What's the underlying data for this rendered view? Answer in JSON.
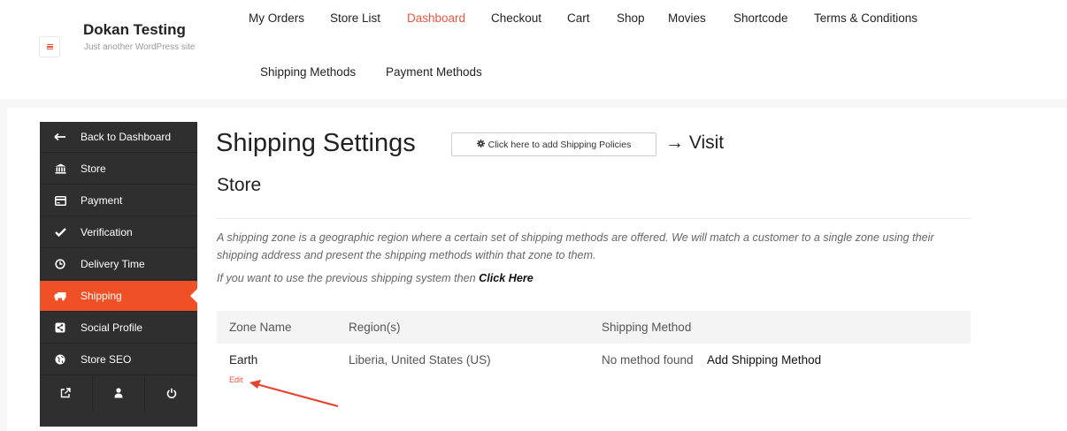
{
  "site": {
    "title": "Dokan Testing",
    "description": "Just another WordPress site"
  },
  "nav": {
    "items": [
      "My Orders",
      "Store List",
      "Dashboard",
      "Checkout",
      "Cart",
      "Shop",
      "Movies",
      "Shortcode",
      "Terms & Conditions",
      "Shipping Methods",
      "Payment Methods"
    ],
    "active": "Dashboard"
  },
  "sidebar": {
    "items": [
      {
        "label": "Back to Dashboard",
        "icon": "arrow-left-icon"
      },
      {
        "label": "Store",
        "icon": "bank-icon"
      },
      {
        "label": "Payment",
        "icon": "credit-card-icon"
      },
      {
        "label": "Verification",
        "icon": "check-icon"
      },
      {
        "label": "Delivery Time",
        "icon": "clock-icon"
      },
      {
        "label": "Shipping",
        "icon": "truck-icon"
      },
      {
        "label": "Social Profile",
        "icon": "share-icon"
      },
      {
        "label": "Store SEO",
        "icon": "globe-icon"
      }
    ],
    "active": "Shipping",
    "footer_icons": [
      "external-link-icon",
      "user-icon",
      "power-icon"
    ]
  },
  "main": {
    "title": "Shipping Settings",
    "policy_button": "Click here to add Shipping Policies",
    "visit": "→ Visit",
    "store_heading": "Store",
    "description": "A shipping zone is a geographic region where a certain set of shipping methods are offered. We will match a customer to a single zone using their shipping address and present the shipping methods within that zone to them.",
    "previous_prefix": "If you want to use the previous shipping system then",
    "previous_link": "Click Here"
  },
  "table": {
    "headers": [
      "Zone Name",
      "Region(s)",
      "Shipping Method"
    ],
    "rows": [
      {
        "zone": "Earth",
        "regions": "Liberia, United States (US)",
        "method": "No method found",
        "add_link": "Add Shipping Method",
        "edit": "Edit"
      }
    ]
  },
  "colors": {
    "accent": "#e8553e",
    "sidebar_bg": "#2f2f2f",
    "sidebar_active": "#f05025",
    "annotation_arrow": "#e8412f"
  }
}
